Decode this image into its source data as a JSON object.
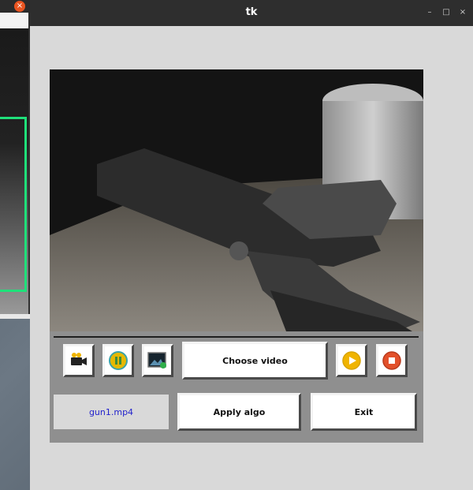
{
  "background_window": {
    "close_glyph": "×"
  },
  "window": {
    "title": "tk",
    "minimize_glyph": "–",
    "maximize_glyph": "□",
    "close_glyph": "×"
  },
  "toolbar": {
    "choose_video_label": "Choose video",
    "play_glyph": "▶",
    "stop_glyph": "■"
  },
  "file_label": "gun1.mp4",
  "apply_label": "Apply algo",
  "exit_label": "Exit",
  "colors": {
    "detection_box": "#1fe07a",
    "play": "#f0b400",
    "stop": "#e2502a",
    "file_text": "#2222cc"
  }
}
